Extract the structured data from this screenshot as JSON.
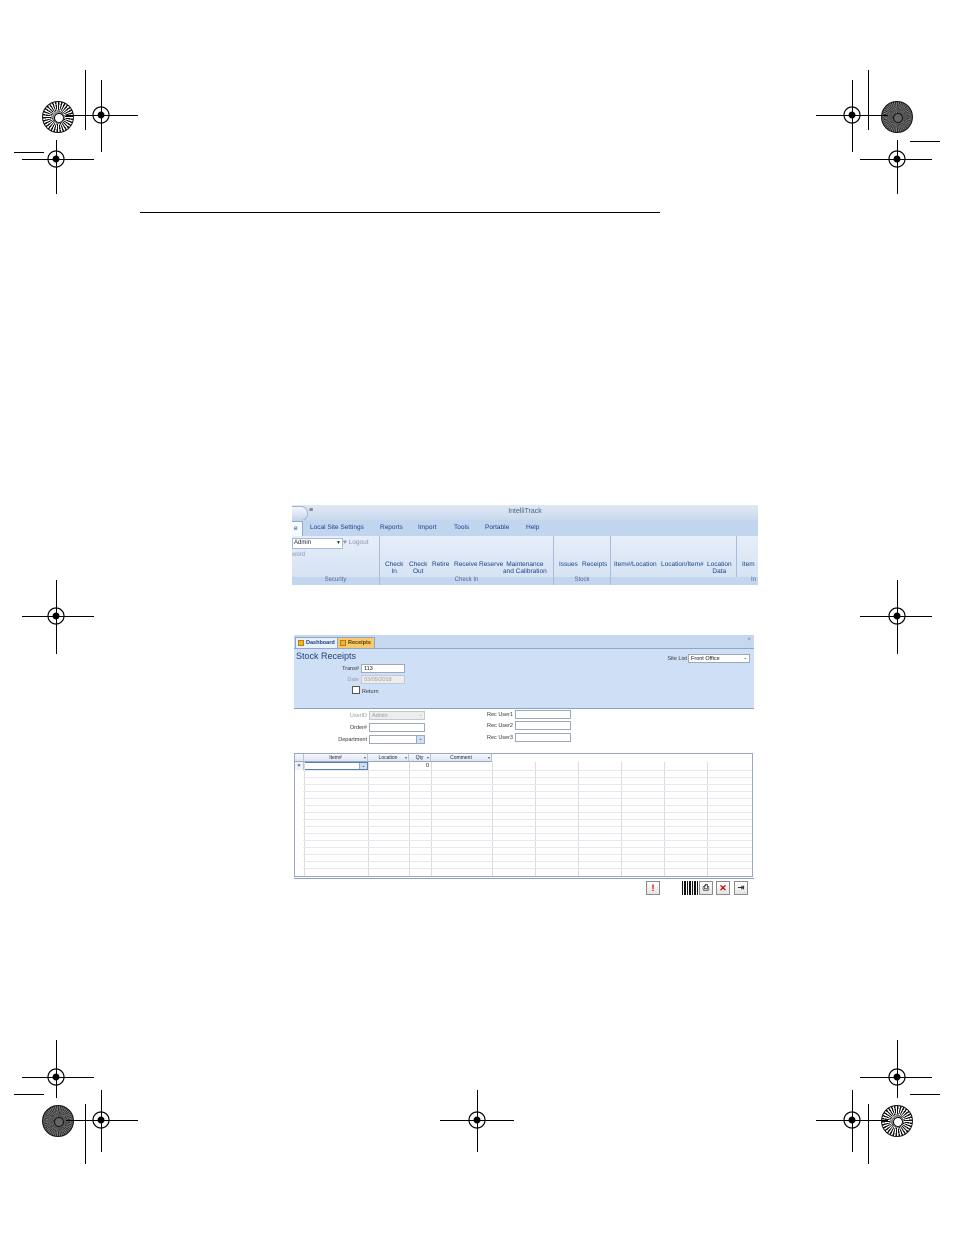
{
  "ribbon": {
    "title": "IntelliTrack",
    "quick_access": "≡",
    "tabs": {
      "home": "e",
      "local_site_settings": "Local Site Settings",
      "reports": "Reports",
      "import": "Import",
      "tools": "Tools",
      "portable": "Portable",
      "help": "Help"
    },
    "security": {
      "user_value": "Admin",
      "logout_label": "Logout",
      "password_label": "word",
      "group_label": "Security"
    },
    "check_in": {
      "check_in": [
        "Check",
        "In"
      ],
      "check_out": [
        "Check",
        "Out"
      ],
      "retire": "Retire",
      "receive": "Receive",
      "reserve": "Reserve",
      "maintenance": [
        "Maintenance",
        "and Calibration"
      ],
      "group_label": "Check In"
    },
    "stock": {
      "issues": "Issues",
      "receipts": "Receipts",
      "group_label": "Stock"
    },
    "inventory": {
      "item_location": "Item#/Location",
      "location_item": "Location/Item#",
      "location_data": [
        "Location",
        "Data"
      ],
      "item": "Item",
      "group_label": "In"
    }
  },
  "form": {
    "tabs": {
      "dashboard": "Dashboard",
      "receipts": "Receipts"
    },
    "close": "×",
    "title": "Stock Receipts",
    "trans_label": "Trans#",
    "trans_value": "113",
    "date_label": "Date",
    "date_value": "03/05/2018",
    "return_label": "Return",
    "site_list_label": "Site List",
    "site_list_value": "Front Office",
    "userid_label": "UserID",
    "userid_value": "Admin",
    "order_label": "Order#",
    "department_label": "Department",
    "recuser1_label": "Rec User1",
    "recuser2_label": "Rec User2",
    "recuser3_label": "Rec User3",
    "grid": {
      "columns": [
        "Item#",
        "Location",
        "Qty",
        "Comment"
      ],
      "new_row_marker": "✶",
      "qty_default": "0"
    },
    "footer_buttons": {
      "alert": "!",
      "print": "⎙",
      "cancel": "✕",
      "exit": "⇥"
    }
  }
}
